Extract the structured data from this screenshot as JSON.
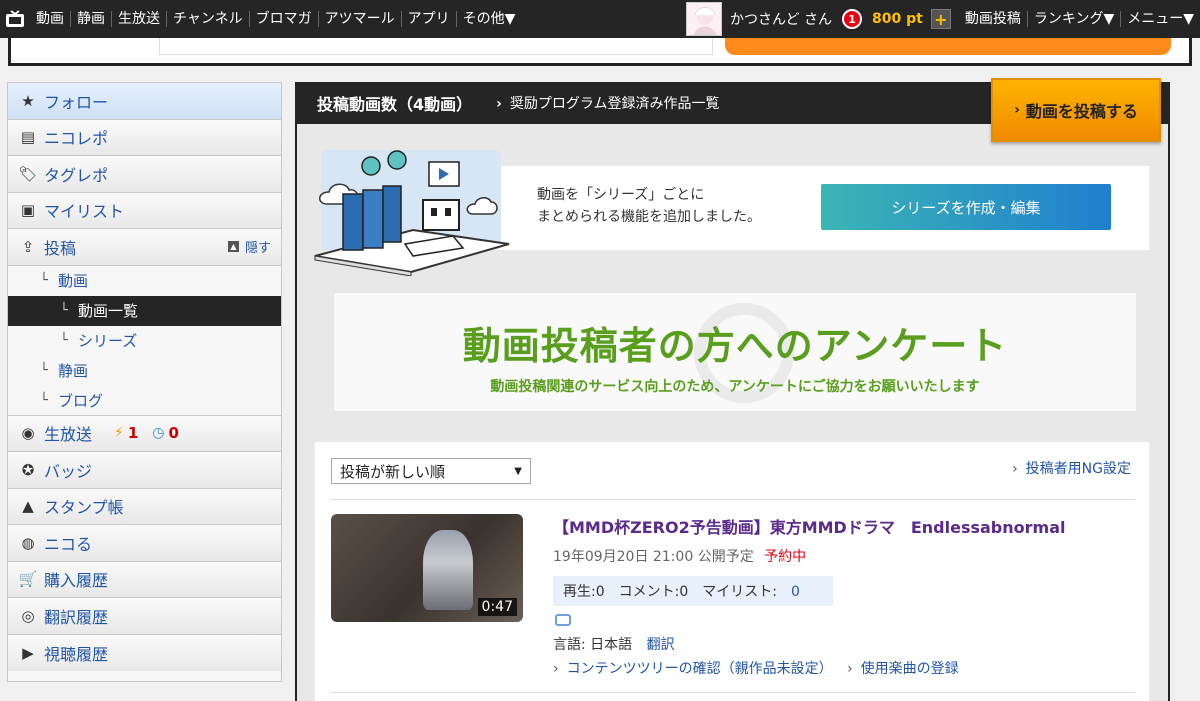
{
  "topnav": {
    "links": [
      "動画",
      "静画",
      "生放送",
      "チャンネル",
      "ブロマガ",
      "アツマール",
      "アプリ",
      "その他▼"
    ],
    "user_name": "かつさんど さん",
    "point_badge": "1",
    "points": "800 pt",
    "plus": "+",
    "right_links": [
      "動画投稿",
      "ランキング▼",
      "メニュー▼"
    ]
  },
  "sidebar": {
    "items": [
      {
        "label": "フォロー",
        "icon": "star-icon",
        "glyph": "★"
      },
      {
        "label": "ニコレポ",
        "icon": "report-icon",
        "glyph": "▤"
      },
      {
        "label": "タグレポ",
        "icon": "tag-icon",
        "glyph": "🏷"
      },
      {
        "label": "マイリスト",
        "icon": "mylist-icon",
        "glyph": "▣"
      },
      {
        "label": "投稿",
        "icon": "upload-icon",
        "glyph": "⇪",
        "hide": "隠す"
      }
    ],
    "sub": [
      {
        "label": "動画",
        "level": 1
      },
      {
        "label": "動画一覧",
        "level": 2
      },
      {
        "label": "シリーズ",
        "level": 2
      },
      {
        "label": "静画",
        "level": 1
      },
      {
        "label": "ブログ",
        "level": 1
      }
    ],
    "items2": [
      {
        "label": "生放送",
        "icon": "live-icon",
        "glyph": "◉",
        "count1": "1",
        "count2": "0"
      },
      {
        "label": "バッジ",
        "icon": "badge-icon",
        "glyph": "✪"
      },
      {
        "label": "スタンプ帳",
        "icon": "stamp-icon",
        "glyph": "▲"
      },
      {
        "label": "ニコる",
        "icon": "nicoru-icon",
        "glyph": "◍"
      },
      {
        "label": "購入履歴",
        "icon": "cart-icon",
        "glyph": "🛒"
      },
      {
        "label": "翻訳履歴",
        "icon": "globe-icon",
        "glyph": "◎"
      },
      {
        "label": "視聴履歴",
        "icon": "history-icon",
        "glyph": "▶"
      }
    ]
  },
  "main": {
    "title": "投稿動画数（4動画）",
    "sub_link": "奨励プログラム登録済み作品一覧",
    "upload_button": "動画を投稿する"
  },
  "series_banner": {
    "line1": "動画を「シリーズ」ごとに",
    "line2": "まとめられる機能を追加しました。",
    "button": "シリーズを作成・編集"
  },
  "survey": {
    "title": "動画投稿者の方へのアンケート",
    "subtitle": "動画投稿関連のサービス向上のため、アンケートにご協力をお願いいたします"
  },
  "videos": {
    "sort": "投稿が新しい順",
    "ng_link": "投稿者用NG設定",
    "item": {
      "title": "【MMD杯ZERO2予告動画】東方MMDドラマ　Endlessabnormal",
      "date": "19年09月20日 21:00 公開予定",
      "status": "予約中",
      "duration": "0:47",
      "play": "再生:0",
      "comment": "コメント:0",
      "mylist_label": "マイリスト:",
      "mylist_value": "0",
      "lang": "言語: 日本語",
      "translate": "翻訳",
      "content_tree": "コンテンツツリーの確認（親作品未設定）",
      "music": "使用楽曲の登録"
    }
  },
  "colors": {
    "nav_bg": "#252525",
    "accent_orange": "#f08a00",
    "link_blue": "#2255aa",
    "survey_green": "#5a9e1e",
    "status_red": "#e60012"
  }
}
